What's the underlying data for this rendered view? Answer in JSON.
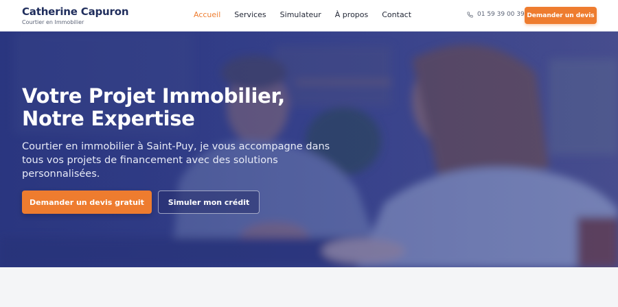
{
  "brand": {
    "name": "Catherine Capuron",
    "subtitle": "Courtier en Immobilier"
  },
  "nav": {
    "items": [
      {
        "label": "Accueil",
        "active": true
      },
      {
        "label": "Services",
        "active": false
      },
      {
        "label": "Simulateur",
        "active": false
      },
      {
        "label": "À propos",
        "active": false
      },
      {
        "label": "Contact",
        "active": false
      }
    ]
  },
  "header": {
    "phone": "01 59 39 00 39",
    "phone_icon": "phone-icon",
    "cta_label": "Demander un devis"
  },
  "hero": {
    "title_line1": "Votre Projet Immobilier,",
    "title_line2": "Notre Expertise",
    "text": "Courtier en immobilier à Saint-Puy, je vous accompagne dans tous vos projets de financement avec des solutions personnalisées.",
    "primary_button": "Demander un devis gratuit",
    "secondary_button": "Simuler mon crédit"
  },
  "colors": {
    "accent": "#ee7c2f",
    "brand": "#1f2d5c",
    "hero_overlay": "#2e3a82"
  }
}
